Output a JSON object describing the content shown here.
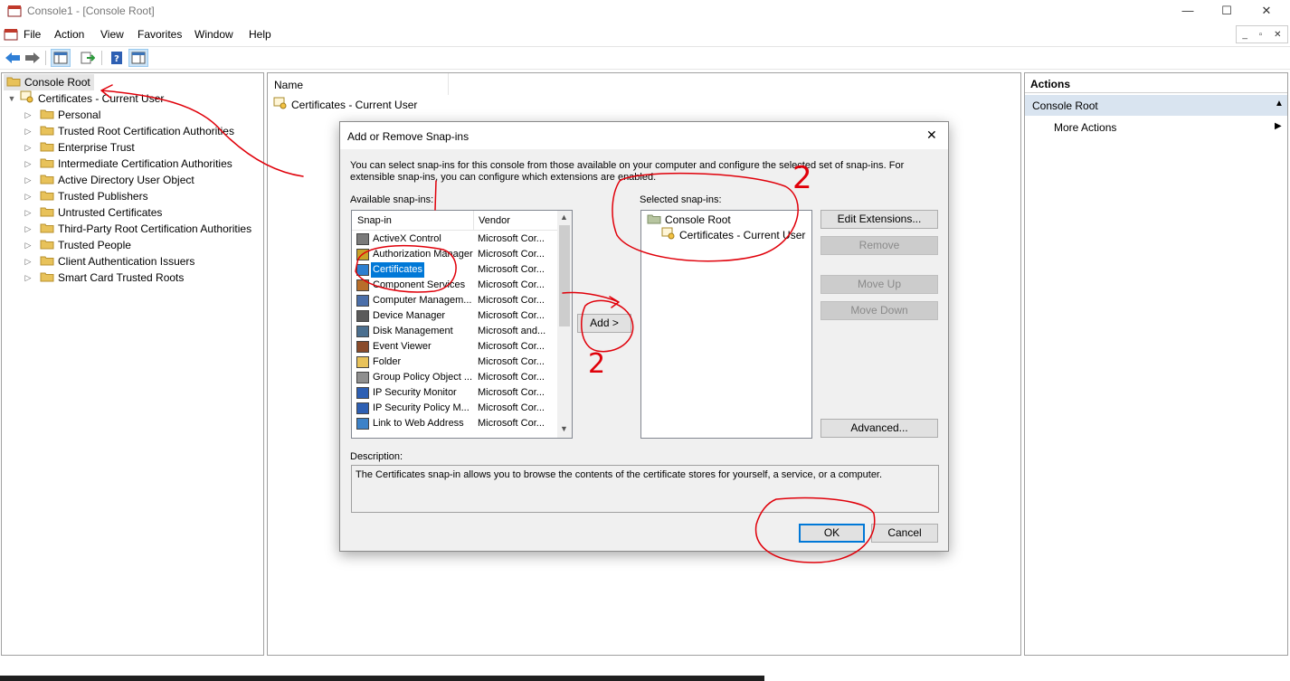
{
  "window": {
    "title": "Console1 - [Console Root]",
    "minimize": "—",
    "maximize": "☐",
    "close": "✕"
  },
  "menu": [
    "File",
    "Action",
    "View",
    "Favorites",
    "Window",
    "Help"
  ],
  "mdi_buttons": {
    "minimize": "_",
    "restore": "▫",
    "close": "✕"
  },
  "tree": {
    "root": "Console Root",
    "child": "Certificates - Current User",
    "stores": [
      "Personal",
      "Trusted Root Certification Authorities",
      "Enterprise Trust",
      "Intermediate Certification Authorities",
      "Active Directory User Object",
      "Trusted Publishers",
      "Untrusted Certificates",
      "Third-Party Root Certification Authorities",
      "Trusted People",
      "Client Authentication Issuers",
      "Smart Card Trusted Roots"
    ]
  },
  "center": {
    "column_name": "Name",
    "items": [
      "Certificates - Current User"
    ]
  },
  "actions": {
    "header": "Actions",
    "section": "Console Root",
    "more_actions": "More Actions"
  },
  "dialog": {
    "title": "Add or Remove Snap-ins",
    "intro_line1": "You can select snap-ins for this console from those available on your computer and configure the selected set of snap-ins. For",
    "intro_line2": "extensible snap-ins, you can configure which extensions are enabled.",
    "available_label": "Available snap-ins:",
    "selected_label": "Selected snap-ins:",
    "columns": {
      "snapin": "Snap-in",
      "vendor": "Vendor"
    },
    "available": [
      {
        "name": "ActiveX Control",
        "vendor": "Microsoft Cor...",
        "icon": "activex-icon"
      },
      {
        "name": "Authorization Manager",
        "vendor": "Microsoft Cor...",
        "icon": "authorization-icon"
      },
      {
        "name": "Certificates",
        "vendor": "Microsoft Cor...",
        "icon": "certificates-icon"
      },
      {
        "name": "Component Services",
        "vendor": "Microsoft Cor...",
        "icon": "component-services-icon"
      },
      {
        "name": "Computer Managem...",
        "vendor": "Microsoft Cor...",
        "icon": "computer-management-icon"
      },
      {
        "name": "Device Manager",
        "vendor": "Microsoft Cor...",
        "icon": "device-manager-icon"
      },
      {
        "name": "Disk Management",
        "vendor": "Microsoft and...",
        "icon": "disk-management-icon"
      },
      {
        "name": "Event Viewer",
        "vendor": "Microsoft Cor...",
        "icon": "event-viewer-icon"
      },
      {
        "name": "Folder",
        "vendor": "Microsoft Cor...",
        "icon": "folder-icon"
      },
      {
        "name": "Group Policy Object ...",
        "vendor": "Microsoft Cor...",
        "icon": "group-policy-icon"
      },
      {
        "name": "IP Security Monitor",
        "vendor": "Microsoft Cor...",
        "icon": "ip-security-monitor-icon"
      },
      {
        "name": "IP Security Policy M...",
        "vendor": "Microsoft Cor...",
        "icon": "ip-security-policy-icon"
      },
      {
        "name": "Link to Web Address",
        "vendor": "Microsoft Cor...",
        "icon": "web-link-icon"
      }
    ],
    "selected_index": 2,
    "selected": {
      "root": "Console Root",
      "child": "Certificates - Current User"
    },
    "buttons": {
      "add": "Add >",
      "edit_extensions": "Edit Extensions...",
      "remove": "Remove",
      "move_up": "Move Up",
      "move_down": "Move Down",
      "advanced": "Advanced...",
      "ok": "OK",
      "cancel": "Cancel"
    },
    "description_label": "Description:",
    "description_text": "The Certificates snap-in allows you to browse the contents of the certificate stores for yourself, a service, or a computer."
  },
  "annotations": {
    "mark_1": "1",
    "mark_2a": "2",
    "mark_2b": "2"
  },
  "colors": {
    "selection": "#0078d7",
    "folder": "#e8c25a",
    "annotation": "#e0000a",
    "actions_header_bg": "#d9e4f0"
  }
}
